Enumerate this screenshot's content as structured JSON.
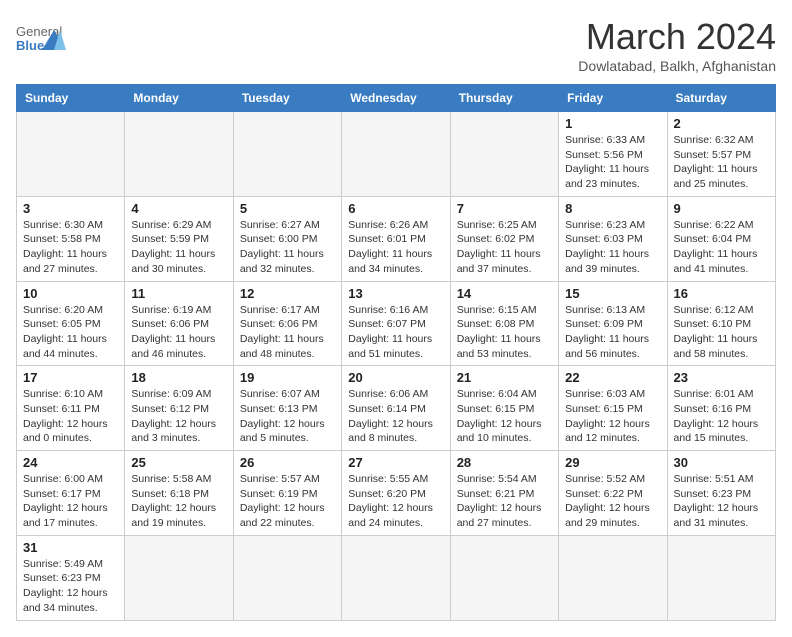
{
  "header": {
    "logo_general": "General",
    "logo_blue": "Blue",
    "month": "March 2024",
    "location": "Dowlatabad, Balkh, Afghanistan"
  },
  "days_of_week": [
    "Sunday",
    "Monday",
    "Tuesday",
    "Wednesday",
    "Thursday",
    "Friday",
    "Saturday"
  ],
  "weeks": [
    [
      {
        "day": "",
        "info": ""
      },
      {
        "day": "",
        "info": ""
      },
      {
        "day": "",
        "info": ""
      },
      {
        "day": "",
        "info": ""
      },
      {
        "day": "",
        "info": ""
      },
      {
        "day": "1",
        "info": "Sunrise: 6:33 AM\nSunset: 5:56 PM\nDaylight: 11 hours\nand 23 minutes."
      },
      {
        "day": "2",
        "info": "Sunrise: 6:32 AM\nSunset: 5:57 PM\nDaylight: 11 hours\nand 25 minutes."
      }
    ],
    [
      {
        "day": "3",
        "info": "Sunrise: 6:30 AM\nSunset: 5:58 PM\nDaylight: 11 hours\nand 27 minutes."
      },
      {
        "day": "4",
        "info": "Sunrise: 6:29 AM\nSunset: 5:59 PM\nDaylight: 11 hours\nand 30 minutes."
      },
      {
        "day": "5",
        "info": "Sunrise: 6:27 AM\nSunset: 6:00 PM\nDaylight: 11 hours\nand 32 minutes."
      },
      {
        "day": "6",
        "info": "Sunrise: 6:26 AM\nSunset: 6:01 PM\nDaylight: 11 hours\nand 34 minutes."
      },
      {
        "day": "7",
        "info": "Sunrise: 6:25 AM\nSunset: 6:02 PM\nDaylight: 11 hours\nand 37 minutes."
      },
      {
        "day": "8",
        "info": "Sunrise: 6:23 AM\nSunset: 6:03 PM\nDaylight: 11 hours\nand 39 minutes."
      },
      {
        "day": "9",
        "info": "Sunrise: 6:22 AM\nSunset: 6:04 PM\nDaylight: 11 hours\nand 41 minutes."
      }
    ],
    [
      {
        "day": "10",
        "info": "Sunrise: 6:20 AM\nSunset: 6:05 PM\nDaylight: 11 hours\nand 44 minutes."
      },
      {
        "day": "11",
        "info": "Sunrise: 6:19 AM\nSunset: 6:06 PM\nDaylight: 11 hours\nand 46 minutes."
      },
      {
        "day": "12",
        "info": "Sunrise: 6:17 AM\nSunset: 6:06 PM\nDaylight: 11 hours\nand 48 minutes."
      },
      {
        "day": "13",
        "info": "Sunrise: 6:16 AM\nSunset: 6:07 PM\nDaylight: 11 hours\nand 51 minutes."
      },
      {
        "day": "14",
        "info": "Sunrise: 6:15 AM\nSunset: 6:08 PM\nDaylight: 11 hours\nand 53 minutes."
      },
      {
        "day": "15",
        "info": "Sunrise: 6:13 AM\nSunset: 6:09 PM\nDaylight: 11 hours\nand 56 minutes."
      },
      {
        "day": "16",
        "info": "Sunrise: 6:12 AM\nSunset: 6:10 PM\nDaylight: 11 hours\nand 58 minutes."
      }
    ],
    [
      {
        "day": "17",
        "info": "Sunrise: 6:10 AM\nSunset: 6:11 PM\nDaylight: 12 hours\nand 0 minutes."
      },
      {
        "day": "18",
        "info": "Sunrise: 6:09 AM\nSunset: 6:12 PM\nDaylight: 12 hours\nand 3 minutes."
      },
      {
        "day": "19",
        "info": "Sunrise: 6:07 AM\nSunset: 6:13 PM\nDaylight: 12 hours\nand 5 minutes."
      },
      {
        "day": "20",
        "info": "Sunrise: 6:06 AM\nSunset: 6:14 PM\nDaylight: 12 hours\nand 8 minutes."
      },
      {
        "day": "21",
        "info": "Sunrise: 6:04 AM\nSunset: 6:15 PM\nDaylight: 12 hours\nand 10 minutes."
      },
      {
        "day": "22",
        "info": "Sunrise: 6:03 AM\nSunset: 6:15 PM\nDaylight: 12 hours\nand 12 minutes."
      },
      {
        "day": "23",
        "info": "Sunrise: 6:01 AM\nSunset: 6:16 PM\nDaylight: 12 hours\nand 15 minutes."
      }
    ],
    [
      {
        "day": "24",
        "info": "Sunrise: 6:00 AM\nSunset: 6:17 PM\nDaylight: 12 hours\nand 17 minutes."
      },
      {
        "day": "25",
        "info": "Sunrise: 5:58 AM\nSunset: 6:18 PM\nDaylight: 12 hours\nand 19 minutes."
      },
      {
        "day": "26",
        "info": "Sunrise: 5:57 AM\nSunset: 6:19 PM\nDaylight: 12 hours\nand 22 minutes."
      },
      {
        "day": "27",
        "info": "Sunrise: 5:55 AM\nSunset: 6:20 PM\nDaylight: 12 hours\nand 24 minutes."
      },
      {
        "day": "28",
        "info": "Sunrise: 5:54 AM\nSunset: 6:21 PM\nDaylight: 12 hours\nand 27 minutes."
      },
      {
        "day": "29",
        "info": "Sunrise: 5:52 AM\nSunset: 6:22 PM\nDaylight: 12 hours\nand 29 minutes."
      },
      {
        "day": "30",
        "info": "Sunrise: 5:51 AM\nSunset: 6:23 PM\nDaylight: 12 hours\nand 31 minutes."
      }
    ],
    [
      {
        "day": "31",
        "info": "Sunrise: 5:49 AM\nSunset: 6:23 PM\nDaylight: 12 hours\nand 34 minutes."
      },
      {
        "day": "",
        "info": ""
      },
      {
        "day": "",
        "info": ""
      },
      {
        "day": "",
        "info": ""
      },
      {
        "day": "",
        "info": ""
      },
      {
        "day": "",
        "info": ""
      },
      {
        "day": "",
        "info": ""
      }
    ]
  ]
}
